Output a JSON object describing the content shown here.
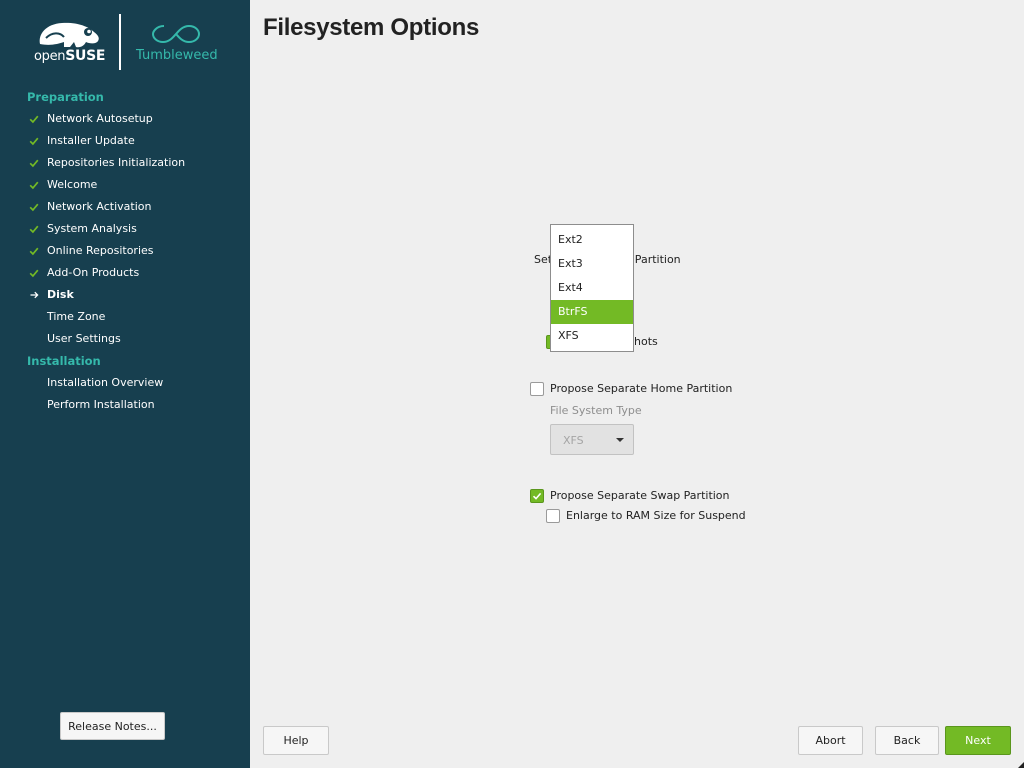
{
  "brand": {
    "opensuse_prefix": "open",
    "opensuse_suffix": "SUSE",
    "tumbleweed": "Tumbleweed",
    "accent": "#35b9ab",
    "green": "#73ba25",
    "sidebar_bg": "#173f4f"
  },
  "sidebar": {
    "sections": [
      {
        "title": "Preparation",
        "items": [
          {
            "label": "Network Autosetup",
            "state": "done"
          },
          {
            "label": "Installer Update",
            "state": "done"
          },
          {
            "label": "Repositories Initialization",
            "state": "done"
          },
          {
            "label": "Welcome",
            "state": "done"
          },
          {
            "label": "Network Activation",
            "state": "done"
          },
          {
            "label": "System Analysis",
            "state": "done"
          },
          {
            "label": "Online Repositories",
            "state": "done"
          },
          {
            "label": "Add-On Products",
            "state": "done"
          },
          {
            "label": "Disk",
            "state": "current"
          },
          {
            "label": "Time Zone",
            "state": "pending"
          },
          {
            "label": "User Settings",
            "state": "pending"
          }
        ]
      },
      {
        "title": "Installation",
        "items": [
          {
            "label": "Installation Overview",
            "state": "pending"
          },
          {
            "label": "Perform Installation",
            "state": "pending"
          }
        ]
      }
    ],
    "release_notes_label": "Release Notes..."
  },
  "main": {
    "title": "Filesystem Options",
    "root_setting_partial_left": "Set",
    "root_setting_partial_right": "t Partition",
    "snapshots_partial": "hots",
    "propose_home_label": "Propose Separate Home Partition",
    "propose_home_checked": false,
    "home_fs_label": "File System Type",
    "home_fs_value": "XFS",
    "propose_swap_label": "Propose Separate Swap Partition",
    "propose_swap_checked": true,
    "enlarge_ram_label": "Enlarge to RAM Size for Suspend",
    "enlarge_ram_checked": false,
    "fs_dropdown": {
      "options": [
        "Ext2",
        "Ext3",
        "Ext4",
        "BtrFS",
        "XFS"
      ],
      "selected": "BtrFS"
    }
  },
  "buttons": {
    "help": "Help",
    "abort": "Abort",
    "back": "Back",
    "next": "Next"
  }
}
